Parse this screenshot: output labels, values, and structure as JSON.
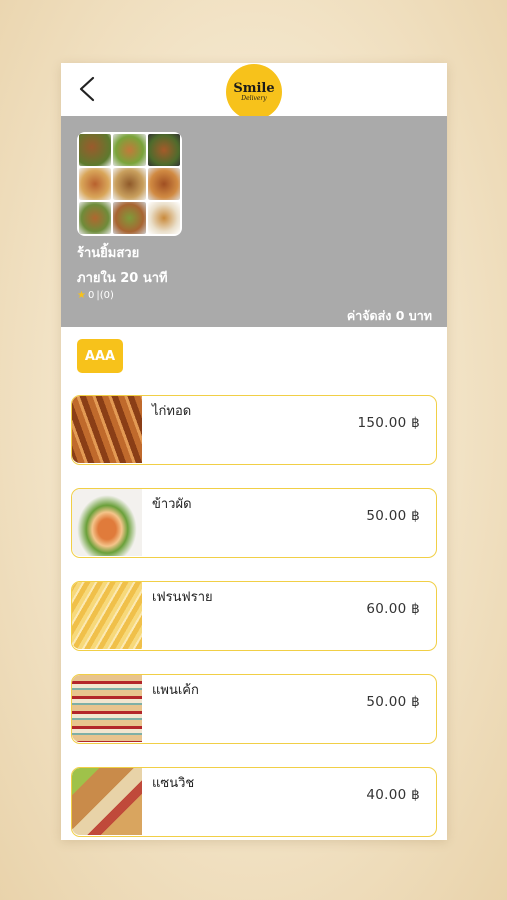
{
  "header": {
    "logo_main": "Smile",
    "logo_sub": "Delivery"
  },
  "shop": {
    "name": "ร้านยิ้มสวย",
    "eta": "ภายใน 20 นาที",
    "rating_value": "0",
    "rating_count": "|(0)",
    "delivery_fee": "ค่าจัดส่ง 0 บาท"
  },
  "category": {
    "label": "AAA"
  },
  "menu": {
    "items": [
      {
        "name": "ไก่ทอด",
        "price": "150.00  ฿"
      },
      {
        "name": "ข้าวผัด",
        "price": "50.00  ฿"
      },
      {
        "name": "เฟรนฟราย",
        "price": "60.00  ฿"
      },
      {
        "name": "แพนเค้ก",
        "price": "50.00  ฿"
      },
      {
        "name": "แซนวิช",
        "price": "40.00  ฿"
      }
    ]
  },
  "colors": {
    "accent": "#f7c21b",
    "banner": "#aaaaaa",
    "card_border": "#f1cf46"
  }
}
